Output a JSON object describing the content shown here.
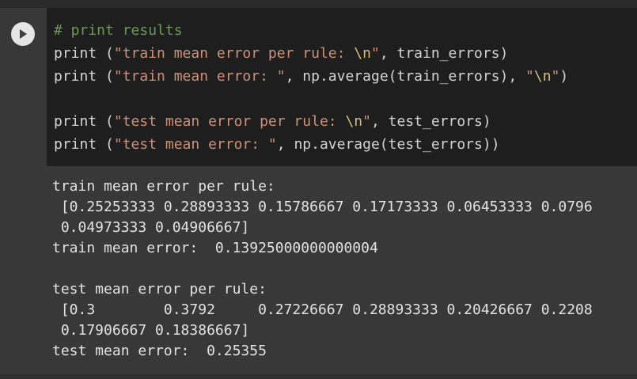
{
  "colors": {
    "background": "#383838",
    "editor_bg": "#1e1e1e",
    "comment": "#6a9955",
    "string": "#ce9178",
    "plain": "#d4d4d4",
    "output_text": "#e3e3e3",
    "run_button": "#e6e6e6"
  },
  "run_button": {
    "icon": "play-icon"
  },
  "code": {
    "line1": {
      "comment": "# print results"
    },
    "line2": {
      "fn": "print (",
      "str1": "\"train mean error per rule: ",
      "esc": "\\n",
      "str2": "\"",
      "rest": ", train_errors)"
    },
    "line3": {
      "fn": "print (",
      "str1": "\"train mean error: \"",
      "rest": ", np.average(train_errors), ",
      "str2": "\"",
      "esc": "\\n",
      "str3": "\"",
      "end": ")"
    },
    "line5": {
      "fn": "print (",
      "str1": "\"test mean error per rule: ",
      "esc": "\\n",
      "str2": "\"",
      "rest": ", test_errors)"
    },
    "line6": {
      "fn": "print (",
      "str1": "\"test mean error: \"",
      "rest": ", np.average(test_errors))"
    }
  },
  "output": {
    "lines": [
      "train mean error per rule:",
      " [0.25253333 0.28893333 0.15786667 0.17173333 0.06453333 0.0796",
      " 0.04973333 0.04906667]",
      "train mean error:  0.13925000000000004",
      "",
      "test mean error per rule:",
      " [0.3        0.3792     0.27226667 0.28893333 0.20426667 0.2208",
      " 0.17906667 0.18386667]",
      "test mean error:  0.25355"
    ]
  }
}
